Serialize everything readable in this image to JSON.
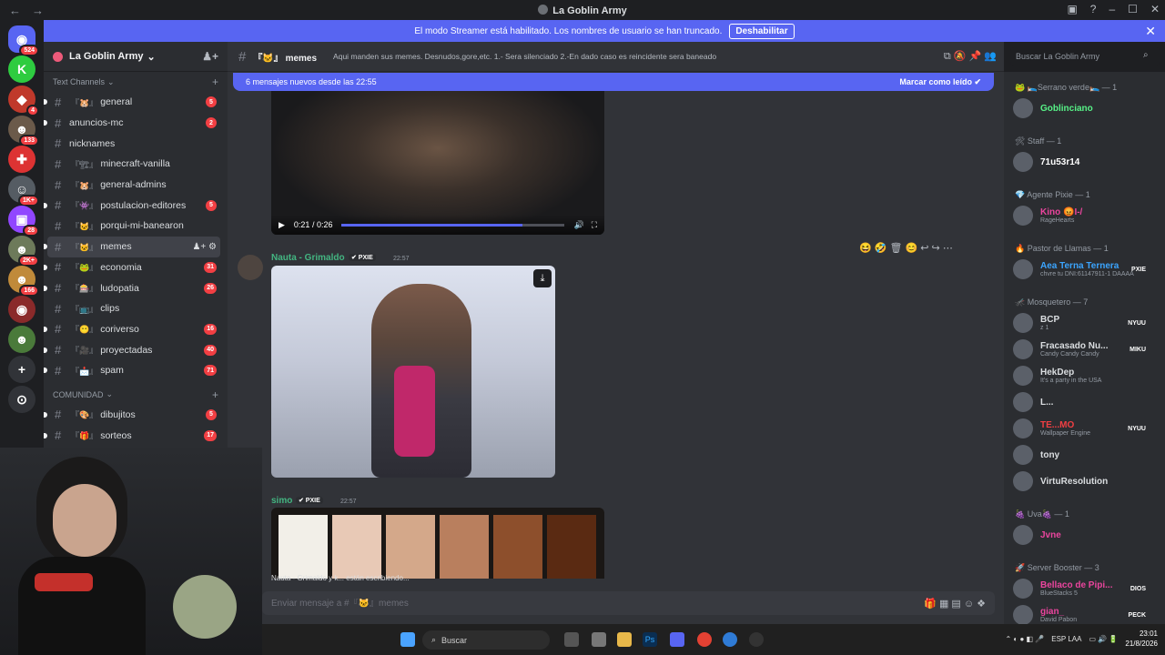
{
  "window": {
    "title": "La Goblin Army",
    "back": "←",
    "forward": "→"
  },
  "banner": {
    "text": "El modo Streamer está habilitado. Los nombres de usuario se han truncado.",
    "button": "Deshabilitar",
    "close": "✕"
  },
  "guilds": [
    {
      "label": "◉",
      "badge": "524",
      "color": "#5865f2"
    },
    {
      "label": "K",
      "badge": "",
      "color": "#2ecc40"
    },
    {
      "label": "◆",
      "badge": "4",
      "color": "#c0392b"
    },
    {
      "label": "☻",
      "badge": "133",
      "color": "#6b5a4a"
    },
    {
      "label": "✚",
      "badge": "",
      "color": "#d33"
    },
    {
      "label": "☺",
      "badge": "1K+",
      "color": "#555c63"
    },
    {
      "label": "▣",
      "badge": "28",
      "color": "#9146ff"
    },
    {
      "label": "☻",
      "badge": "2K+",
      "color": "#6d7a5a"
    },
    {
      "label": "☻",
      "badge": "166",
      "color": "#c08a3a"
    },
    {
      "label": "◉",
      "badge": "",
      "color": "#8a2a2a"
    },
    {
      "label": "☻",
      "badge": "",
      "color": "#4a7a3a"
    },
    {
      "label": "+",
      "badge": "",
      "color": "#313338"
    },
    {
      "label": "⊙",
      "badge": "",
      "color": "#313338"
    }
  ],
  "server": {
    "name": "La Goblin Army",
    "chevron": "⌄",
    "invite": "♟+"
  },
  "categories": {
    "text": "Text Channels",
    "community": "COMUNIDAD",
    "plus": "+"
  },
  "channels": [
    {
      "emoji": "『🐹』",
      "name": "general",
      "badge": "5"
    },
    {
      "emoji": "",
      "name": "anuncios-mc",
      "badge": "2"
    },
    {
      "emoji": "",
      "name": "nicknames",
      "badge": ""
    },
    {
      "emoji": "『🏗』",
      "name": "minecraft-vanilla",
      "badge": ""
    },
    {
      "emoji": "『🐹』",
      "name": "general-admins",
      "badge": ""
    },
    {
      "emoji": "『👾』",
      "name": "postulacion-editores",
      "badge": "5"
    },
    {
      "emoji": "『🐱』",
      "name": "porqui-mi-banearon",
      "badge": ""
    },
    {
      "emoji": "『🐱』",
      "name": "memes",
      "badge": "",
      "active": true,
      "icons": "♟+ ⚙"
    },
    {
      "emoji": "『🐸』",
      "name": "economia",
      "badge": "31"
    },
    {
      "emoji": "『🎰』",
      "name": "ludopatia",
      "badge": "26"
    },
    {
      "emoji": "『📺』",
      "name": "clips",
      "badge": ""
    },
    {
      "emoji": "『😶』",
      "name": "coriverso",
      "badge": "16"
    },
    {
      "emoji": "『🎥』",
      "name": "proyectadas",
      "badge": "40"
    },
    {
      "emoji": "『📩』",
      "name": "spam",
      "badge": "71"
    }
  ],
  "community_channels": [
    {
      "emoji": "『🎨』",
      "name": "dibujitos",
      "badge": "5"
    },
    {
      "emoji": "『🎁』",
      "name": "sorteos",
      "badge": "17"
    }
  ],
  "header": {
    "hash": "#",
    "emoji": "『🐱』",
    "channel": "memes",
    "topic": "Aqui manden sus memes. Desnudos,gore,etc. 1.- Sera silenciado 2.-En dado caso es reincidente sera baneado",
    "tools": "⧉ 🔕 📌 👥"
  },
  "search": {
    "placeholder": "Buscar La Goblin Army",
    "icon": "⌕"
  },
  "newbar": {
    "text": "6 mensajes nuevos desde las 22:55",
    "mark": "Marcar como leído ✔"
  },
  "video": {
    "play": "▶",
    "time": "0:21 / 0:26",
    "progress": 0.81,
    "vol": "🔊",
    "full": "⛶"
  },
  "message_tools": "😆 🤣 🗑 😊 ↩ ↪ ⋯",
  "messages": [
    {
      "author": "Nauta - Grimaldo",
      "tag": "✔ PXIE",
      "time": "22:57",
      "color": "#43b581"
    },
    {
      "author": "simo",
      "tag": "✔ PXIE",
      "time": "22:57",
      "color": "#43b581"
    }
  ],
  "image_download": "⤓",
  "swatches": [
    "#f2efe8",
    "#e8c9b6",
    "#d4a88a",
    "#b97f5e",
    "#8d4f2c",
    "#5a2a12"
  ],
  "typing": "Nauta - Grimaldo y k... están escribiendo...",
  "input": {
    "placeholder": "Enviar mensaje a #『🐱』memes",
    "tools": "🎁 ▦ ▤ ☺ ❖"
  },
  "members": [
    {
      "cat": "🐸 🛌Serrano verde🛌 — 1",
      "items": [
        {
          "name": "Goblinciano",
          "stat": "",
          "color": "#57f287",
          "tag": ""
        }
      ]
    },
    {
      "cat": "🛠 Staff — 1",
      "items": [
        {
          "name": "71u53r14",
          "stat": "",
          "color": "#ffffff",
          "tag": ""
        }
      ]
    },
    {
      "cat": "💎 Agente Pixie — 1",
      "items": [
        {
          "name": "Kino 😡I-/",
          "stat": "RageHearts",
          "color": "#eb459e",
          "tag": ""
        }
      ]
    },
    {
      "cat": "🔥 Pastor de Llamas — 1",
      "items": [
        {
          "name": "Aea Terna Ternera",
          "stat": "chvre tu DNI:61147911-1 DAAAA",
          "color": "#3ba5ff",
          "tag": "PXIE"
        }
      ]
    },
    {
      "cat": "🦟 Mosquetero — 7",
      "items": [
        {
          "name": "BCP",
          "stat": "z 1",
          "color": "#dbdee1",
          "tag": "NYUU"
        },
        {
          "name": "Fracasado Nu...",
          "stat": "Candy Candy Candy",
          "color": "#dbdee1",
          "tag": "MIKU"
        },
        {
          "name": "HekDep",
          "stat": "It's a party in the USA",
          "color": "#dbdee1",
          "tag": ""
        },
        {
          "name": "L...",
          "stat": "",
          "color": "#dbdee1",
          "tag": ""
        },
        {
          "name": "TE...MO",
          "stat": "Wallpaper Engine",
          "color": "#f23f43",
          "tag": "NYUU"
        },
        {
          "name": "tony",
          "stat": "",
          "color": "#dbdee1",
          "tag": ""
        },
        {
          "name": "VirtuResolution",
          "stat": "",
          "color": "#dbdee1",
          "tag": ""
        }
      ]
    },
    {
      "cat": "🍇 Uva🍇 — 1",
      "items": [
        {
          "name": "Jvne",
          "stat": "",
          "color": "#eb459e",
          "tag": ""
        }
      ]
    },
    {
      "cat": "🚀 Server Booster — 3",
      "items": [
        {
          "name": "Bellaco de Pipi...",
          "stat": "BlueStacks 5",
          "color": "#eb459e",
          "tag": "DIOS"
        },
        {
          "name": "gian_",
          "stat": "David Pabon",
          "color": "#eb459e",
          "tag": "PECK"
        }
      ]
    }
  ],
  "taskbar": {
    "search": "Buscar",
    "lang": "ESP LAA",
    "time": "23:01",
    "date": "21/8/2026"
  }
}
